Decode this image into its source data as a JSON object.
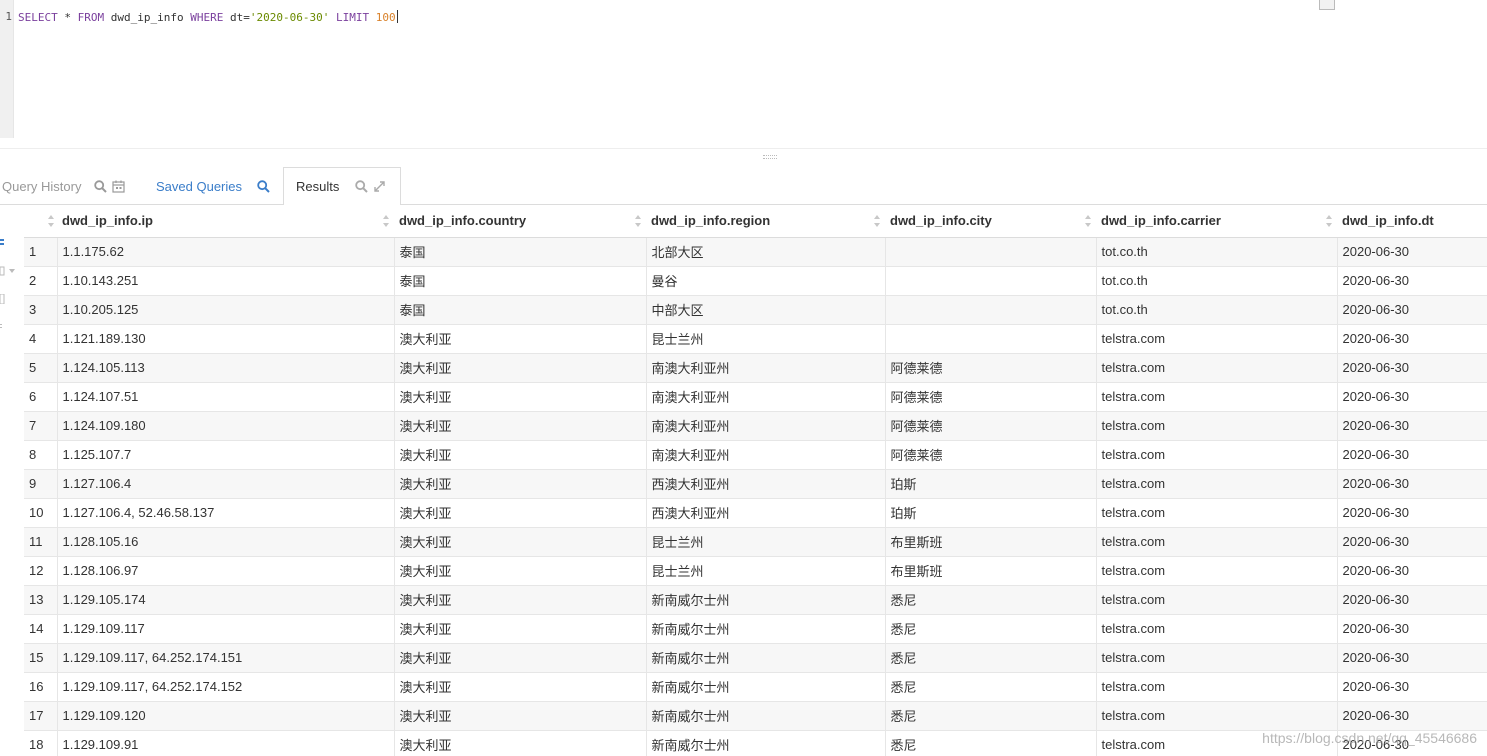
{
  "editor": {
    "line_number": "1",
    "tokens": {
      "select": "SELECT",
      "star": " * ",
      "from": "FROM",
      "table": " dwd_ip_info ",
      "where": "WHERE",
      "cond": " dt=",
      "date": "'2020-06-30'",
      "space": " ",
      "limit": "LIMIT",
      "space2": " ",
      "limit_value": "100"
    }
  },
  "tabs": {
    "history": "Query History",
    "saved": "Saved Queries",
    "results": "Results"
  },
  "table": {
    "headers": {
      "ip": "dwd_ip_info.ip",
      "country": "dwd_ip_info.country",
      "region": "dwd_ip_info.region",
      "city": "dwd_ip_info.city",
      "carrier": "dwd_ip_info.carrier",
      "dt": "dwd_ip_info.dt"
    },
    "rows": [
      {
        "n": "1",
        "ip": "1.1.175.62",
        "country": "泰国",
        "region": "北部大区",
        "city": "",
        "carrier": "tot.co.th",
        "dt": "2020-06-30"
      },
      {
        "n": "2",
        "ip": "1.10.143.251",
        "country": "泰国",
        "region": "曼谷",
        "city": "",
        "carrier": "tot.co.th",
        "dt": "2020-06-30"
      },
      {
        "n": "3",
        "ip": "1.10.205.125",
        "country": "泰国",
        "region": "中部大区",
        "city": "",
        "carrier": "tot.co.th",
        "dt": "2020-06-30"
      },
      {
        "n": "4",
        "ip": "1.121.189.130",
        "country": "澳大利亚",
        "region": "昆士兰州",
        "city": "",
        "carrier": "telstra.com",
        "dt": "2020-06-30"
      },
      {
        "n": "5",
        "ip": "1.124.105.113",
        "country": "澳大利亚",
        "region": "南澳大利亚州",
        "city": "阿德莱德",
        "carrier": "telstra.com",
        "dt": "2020-06-30"
      },
      {
        "n": "6",
        "ip": "1.124.107.51",
        "country": "澳大利亚",
        "region": "南澳大利亚州",
        "city": "阿德莱德",
        "carrier": "telstra.com",
        "dt": "2020-06-30"
      },
      {
        "n": "7",
        "ip": "1.124.109.180",
        "country": "澳大利亚",
        "region": "南澳大利亚州",
        "city": "阿德莱德",
        "carrier": "telstra.com",
        "dt": "2020-06-30"
      },
      {
        "n": "8",
        "ip": "1.125.107.7",
        "country": "澳大利亚",
        "region": "南澳大利亚州",
        "city": "阿德莱德",
        "carrier": "telstra.com",
        "dt": "2020-06-30"
      },
      {
        "n": "9",
        "ip": "1.127.106.4",
        "country": "澳大利亚",
        "region": "西澳大利亚州",
        "city": "珀斯",
        "carrier": "telstra.com",
        "dt": "2020-06-30"
      },
      {
        "n": "10",
        "ip": "1.127.106.4, 52.46.58.137",
        "country": "澳大利亚",
        "region": "西澳大利亚州",
        "city": "珀斯",
        "carrier": "telstra.com",
        "dt": "2020-06-30"
      },
      {
        "n": "11",
        "ip": "1.128.105.16",
        "country": "澳大利亚",
        "region": "昆士兰州",
        "city": "布里斯班",
        "carrier": "telstra.com",
        "dt": "2020-06-30"
      },
      {
        "n": "12",
        "ip": "1.128.106.97",
        "country": "澳大利亚",
        "region": "昆士兰州",
        "city": "布里斯班",
        "carrier": "telstra.com",
        "dt": "2020-06-30"
      },
      {
        "n": "13",
        "ip": "1.129.105.174",
        "country": "澳大利亚",
        "region": "新南威尔士州",
        "city": "悉尼",
        "carrier": "telstra.com",
        "dt": "2020-06-30"
      },
      {
        "n": "14",
        "ip": "1.129.109.117",
        "country": "澳大利亚",
        "region": "新南威尔士州",
        "city": "悉尼",
        "carrier": "telstra.com",
        "dt": "2020-06-30"
      },
      {
        "n": "15",
        "ip": "1.129.109.117, 64.252.174.151",
        "country": "澳大利亚",
        "region": "新南威尔士州",
        "city": "悉尼",
        "carrier": "telstra.com",
        "dt": "2020-06-30"
      },
      {
        "n": "16",
        "ip": "1.129.109.117, 64.252.174.152",
        "country": "澳大利亚",
        "region": "新南威尔士州",
        "city": "悉尼",
        "carrier": "telstra.com",
        "dt": "2020-06-30"
      },
      {
        "n": "17",
        "ip": "1.129.109.120",
        "country": "澳大利亚",
        "region": "新南威尔士州",
        "city": "悉尼",
        "carrier": "telstra.com",
        "dt": "2020-06-30"
      },
      {
        "n": "18",
        "ip": "1.129.109.91",
        "country": "澳大利亚",
        "region": "新南威尔士州",
        "city": "悉尼",
        "carrier": "telstra.com",
        "dt": "2020-06-30"
      }
    ]
  },
  "watermark": "https://blog.csdn.net/qq_45546686",
  "icons": {
    "history_search": "search-icon",
    "history_calendar": "calendar-icon",
    "saved_search": "search-icon",
    "results_search": "search-icon",
    "results_expand": "expand-icon"
  },
  "colors": {
    "keyword": "#7a3f9d",
    "string": "#6a8a00",
    "number": "#d9822b",
    "link_tab": "#3a7dc9"
  }
}
